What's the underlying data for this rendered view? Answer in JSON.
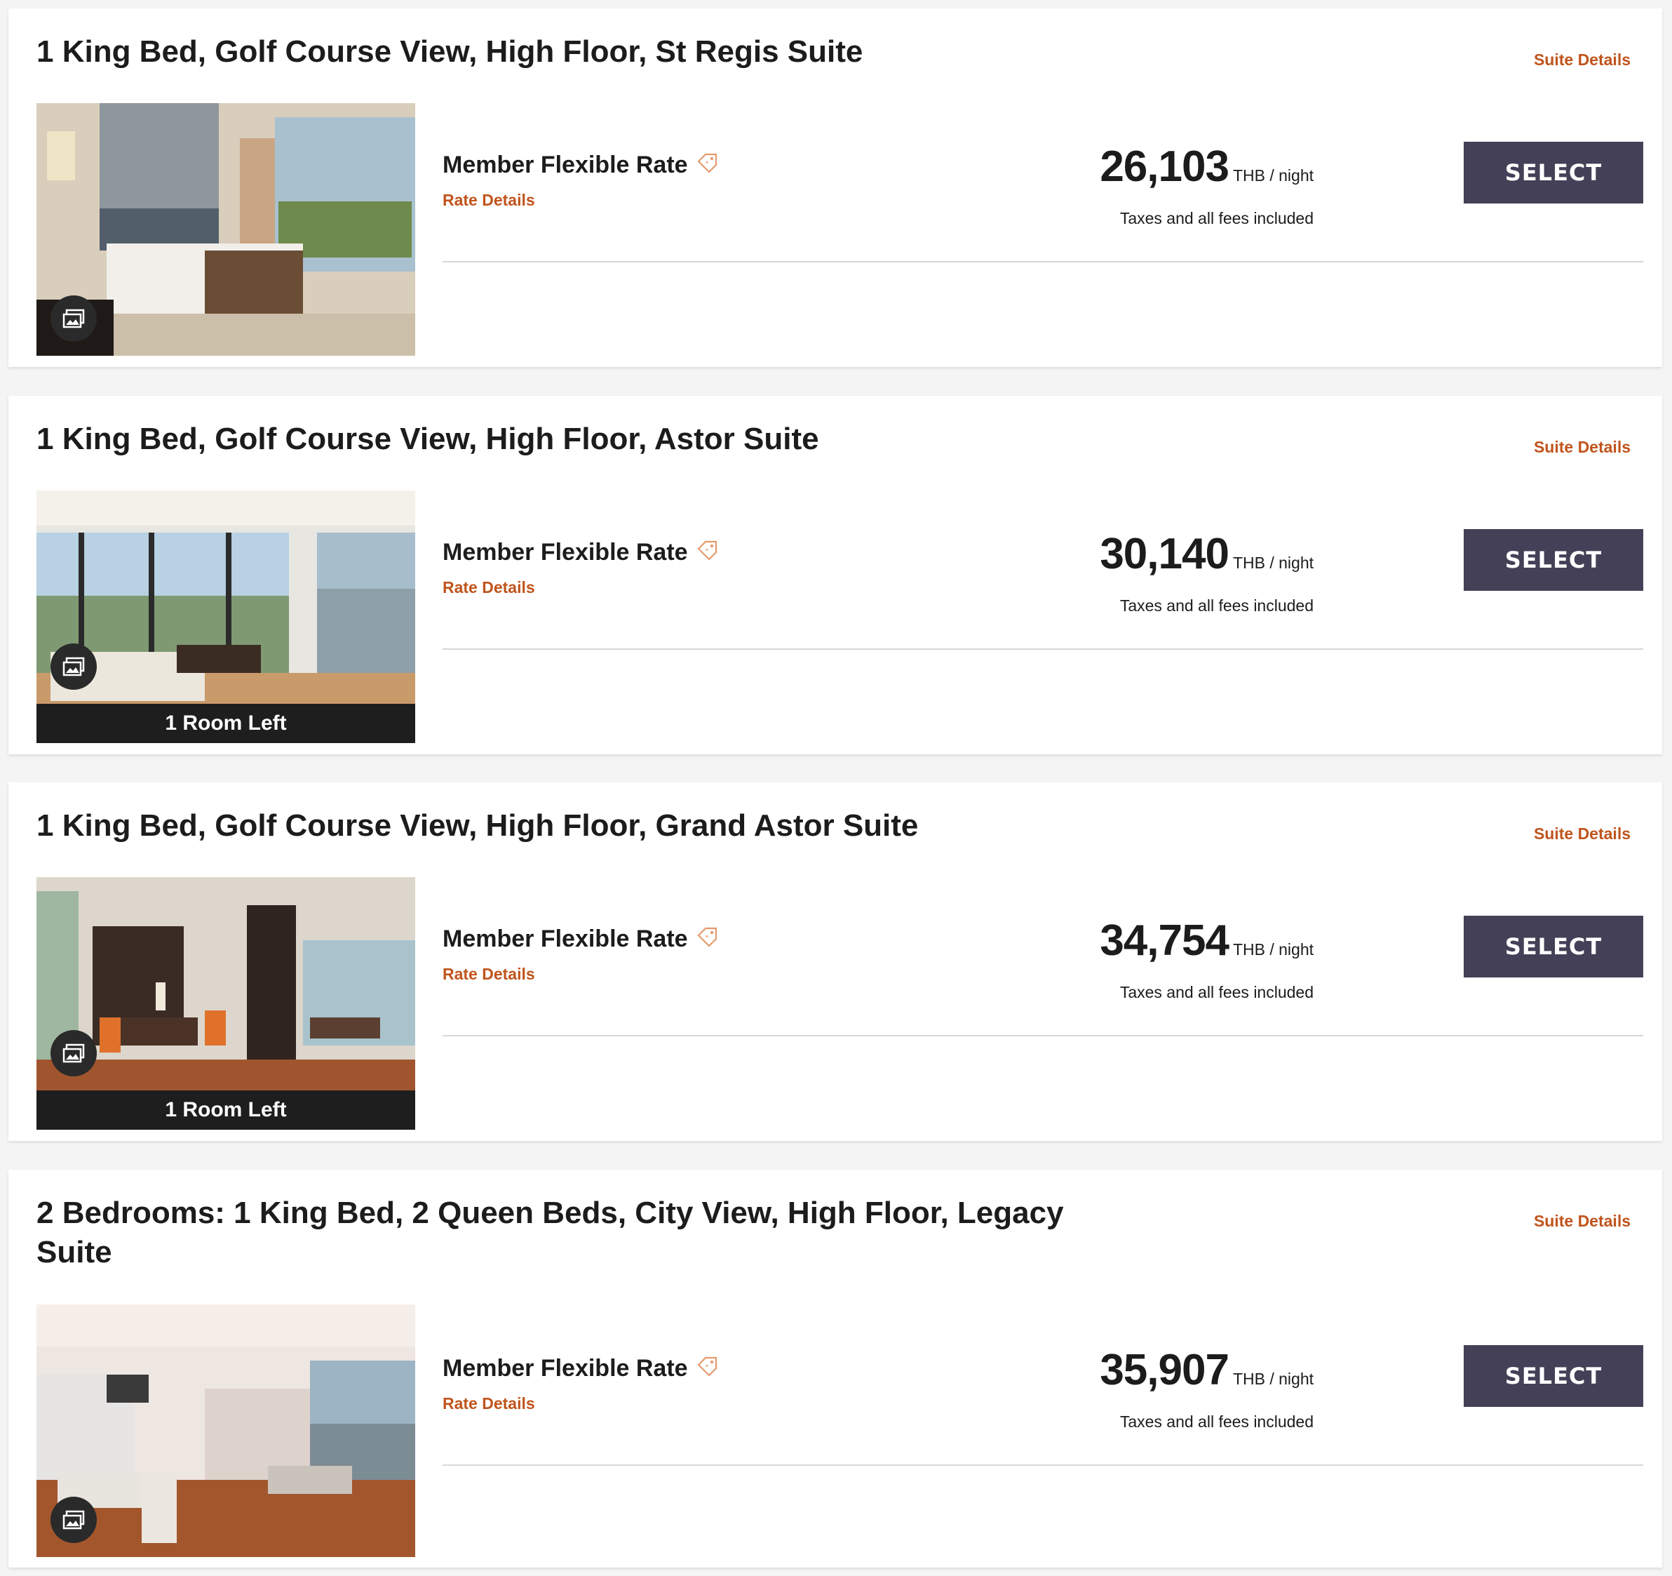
{
  "colors": {
    "accent": "#c0541c",
    "button": "#434057",
    "divider": "#d7d7d7"
  },
  "rooms": [
    {
      "title": "1 King Bed, Golf Course View, High Floor, St Regis Suite",
      "suite_details": "Suite Details",
      "rate_name": "Member Flexible Rate",
      "rate_details": "Rate Details",
      "price": "26,103",
      "price_unit": "THB / night",
      "fees_note": "Taxes and all fees included",
      "select_label": "SELECT",
      "availability": "",
      "photo_icon": "gallery-icon",
      "tag_icon": "member-rate-tag-icon"
    },
    {
      "title": "1 King Bed, Golf Course View, High Floor, Astor Suite",
      "suite_details": "Suite Details",
      "rate_name": "Member Flexible Rate",
      "rate_details": "Rate Details",
      "price": "30,140",
      "price_unit": "THB / night",
      "fees_note": "Taxes and all fees included",
      "select_label": "SELECT",
      "availability": "1 Room Left",
      "photo_icon": "gallery-icon",
      "tag_icon": "member-rate-tag-icon"
    },
    {
      "title": "1 King Bed, Golf Course View, High Floor, Grand Astor Suite",
      "suite_details": "Suite Details",
      "rate_name": "Member Flexible Rate",
      "rate_details": "Rate Details",
      "price": "34,754",
      "price_unit": "THB / night",
      "fees_note": "Taxes and all fees included",
      "select_label": "SELECT",
      "availability": "1 Room Left",
      "photo_icon": "gallery-icon",
      "tag_icon": "member-rate-tag-icon"
    },
    {
      "title": "2 Bedrooms: 1 King Bed, 2 Queen Beds, City View, High Floor, Legacy Suite",
      "suite_details": "Suite Details",
      "rate_name": "Member Flexible Rate",
      "rate_details": "Rate Details",
      "price": "35,907",
      "price_unit": "THB / night",
      "fees_note": "Taxes and all fees included",
      "select_label": "SELECT",
      "availability": "",
      "photo_icon": "gallery-icon",
      "tag_icon": "member-rate-tag-icon"
    }
  ]
}
